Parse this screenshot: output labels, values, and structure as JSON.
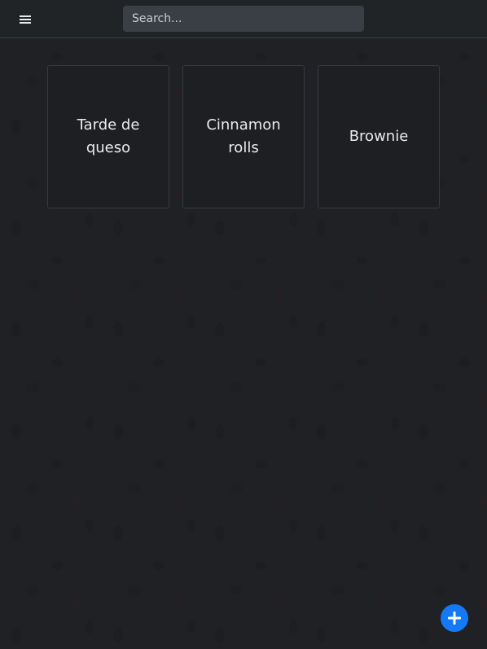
{
  "header": {
    "menu_icon": "hamburger-menu-icon",
    "search": {
      "placeholder": "Search...",
      "value": ""
    }
  },
  "cards": [
    {
      "title": "Tarde de queso"
    },
    {
      "title": "Cinnamon rolls"
    },
    {
      "title": "Brownie"
    }
  ],
  "fab": {
    "icon": "plus-icon",
    "color": "#1479f5"
  }
}
